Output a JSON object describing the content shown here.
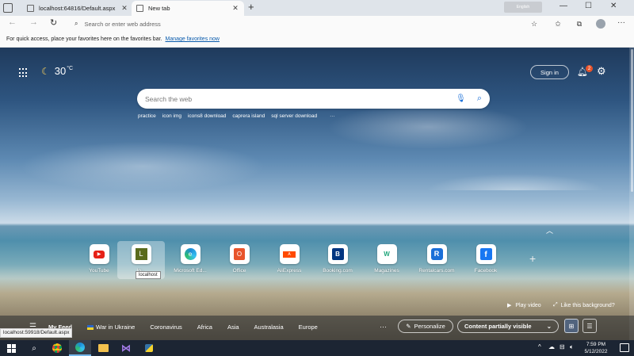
{
  "browser": {
    "tabs": [
      {
        "title": "localhost:64816/Default.aspx",
        "active": false
      },
      {
        "title": "New tab",
        "active": true
      }
    ],
    "ime_label": "English",
    "address_placeholder": "Search or enter web address",
    "favorites_prompt": "For quick access, place your favorites here on the favorites bar.",
    "favorites_link": "Manage favorites now"
  },
  "ntp": {
    "weather": {
      "temp": "30",
      "unit": "°C"
    },
    "signin_label": "Sign in",
    "notification_count": "2",
    "search_placeholder": "Search the web",
    "trending": [
      "practice",
      "icon img",
      "icons8 download",
      "caprera island",
      "sql server download"
    ],
    "trending_more": "···",
    "quick_links": [
      {
        "label": "YouTube",
        "tile_color": "#e62117",
        "glyph": "▶"
      },
      {
        "label": "localhost",
        "tile_color": "#5a6b1d",
        "glyph": "L"
      },
      {
        "label": "Microsoft Ed...",
        "tile_color": "#1c8ad6",
        "glyph": "e"
      },
      {
        "label": "Office",
        "tile_color": "#e8542b",
        "glyph": "O"
      },
      {
        "label": "AliExpress",
        "tile_color": "#ff4a00",
        "glyph": "A"
      },
      {
        "label": "Booking.com",
        "tile_color": "#003580",
        "glyph": "B"
      },
      {
        "label": "Magazines",
        "tile_color": "#1fa57a",
        "glyph": "W"
      },
      {
        "label": "Rentalcars.com",
        "tile_color": "#1a6fd8",
        "glyph": "R"
      },
      {
        "label": "Facebook",
        "tile_color": "#1877f2",
        "glyph": "f"
      }
    ],
    "quick_link_truncated_label": "lo...",
    "tooltip": "localhost",
    "play_video": "Play video",
    "like_background": "Like this background?",
    "feed_tabs": [
      "My Feed",
      "War in Ukraine",
      "Coronavirus",
      "Africa",
      "Asia",
      "Australasia",
      "Europe"
    ],
    "feed_more": "···",
    "personalize_label": "Personalize",
    "content_visibility": "Content partially visible"
  },
  "status_url": "localhost:59918/Default.aspx",
  "taskbar": {
    "time": "7:59 PM",
    "date": "5/12/2022"
  }
}
